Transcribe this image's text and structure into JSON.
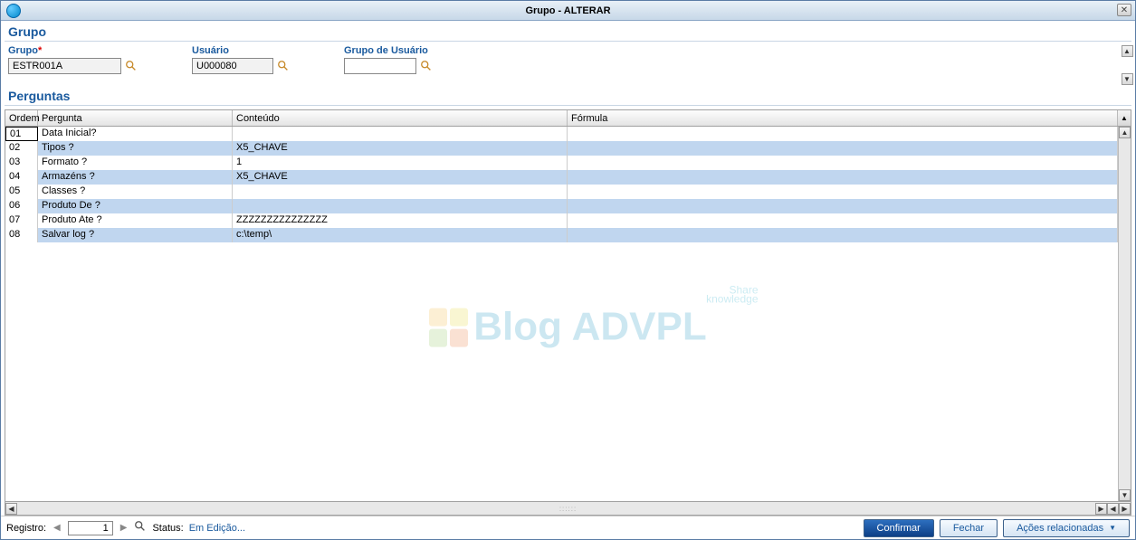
{
  "window": {
    "title": "Grupo - ALTERAR"
  },
  "sections": {
    "grupo_title": "Grupo",
    "perguntas_title": "Perguntas"
  },
  "fields": {
    "grupo": {
      "label": "Grupo",
      "value": "ESTR001A"
    },
    "usuario": {
      "label": "Usuário",
      "value": "U000080"
    },
    "grupo_usuario": {
      "label": "Grupo de Usuário",
      "value": ""
    }
  },
  "table": {
    "headers": {
      "ordem": "Ordem",
      "pergunta": "Pergunta",
      "conteudo": "Conteúdo",
      "formula": "Fórmula"
    },
    "rows": [
      {
        "ordem": "01",
        "pergunta": "Data Inicial?",
        "conteudo": "",
        "formula": ""
      },
      {
        "ordem": "02",
        "pergunta": "Tipos ?",
        "conteudo": "X5_CHAVE",
        "formula": ""
      },
      {
        "ordem": "03",
        "pergunta": "Formato ?",
        "conteudo": "1",
        "formula": ""
      },
      {
        "ordem": "04",
        "pergunta": "Armazéns ?",
        "conteudo": "X5_CHAVE",
        "formula": ""
      },
      {
        "ordem": "05",
        "pergunta": "Classes ?",
        "conteudo": "",
        "formula": ""
      },
      {
        "ordem": "06",
        "pergunta": "Produto De ?",
        "conteudo": "",
        "formula": ""
      },
      {
        "ordem": "07",
        "pergunta": "Produto Ate ?",
        "conteudo": "ZZZZZZZZZZZZZZZ",
        "formula": ""
      },
      {
        "ordem": "08",
        "pergunta": "Salvar log  ?",
        "conteudo": "c:\\temp\\",
        "formula": ""
      }
    ]
  },
  "status": {
    "registro_label": "Registro:",
    "registro_value": "1",
    "status_label": "Status:",
    "status_value": "Em Edição..."
  },
  "buttons": {
    "confirmar": "Confirmar",
    "fechar": "Fechar",
    "acoes": "Ações relacionadas"
  },
  "watermark": {
    "line1": "Share",
    "line2": "knowledge",
    "main": "Blog ADVPL"
  }
}
